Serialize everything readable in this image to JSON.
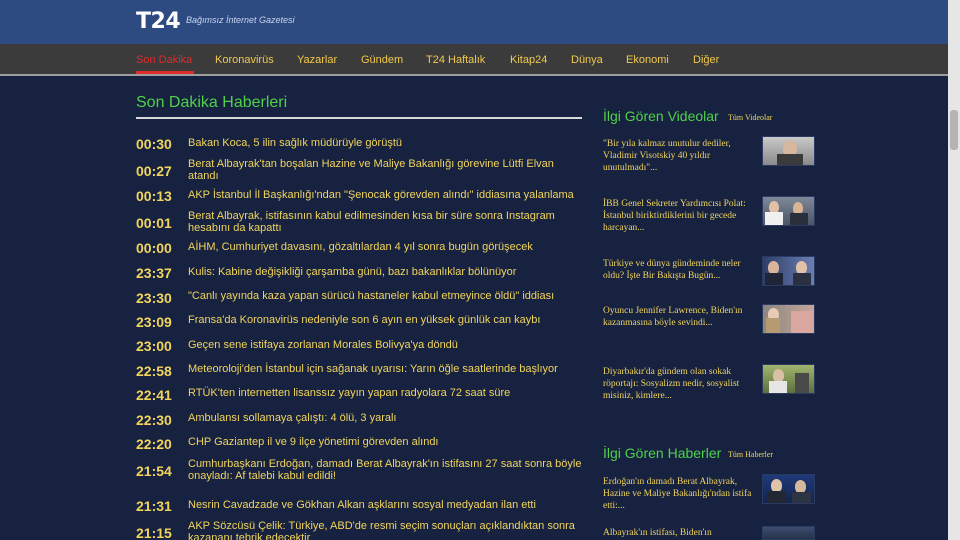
{
  "site": {
    "logo": "T24",
    "tagline": "Bağımsız İnternet Gazetesi"
  },
  "nav": {
    "items": [
      {
        "label": "Son Dakika",
        "active": true
      },
      {
        "label": "Koronavirüs"
      },
      {
        "label": "Yazarlar"
      },
      {
        "label": "Gündem"
      },
      {
        "label": "T24 Haftalık"
      },
      {
        "label": "Kitap24"
      },
      {
        "label": "Dünya"
      },
      {
        "label": "Ekonomi"
      },
      {
        "label": "Diğer"
      }
    ]
  },
  "main": {
    "title": "Son Dakika Haberleri",
    "news": [
      {
        "time": "00:30",
        "title": "Bakan Koca, 5 ilin sağlık müdürüyle görüştü"
      },
      {
        "time": "00:27",
        "title": "Berat Albayrak'tan boşalan Hazine ve Maliye Bakanlığı görevine Lütfi Elvan atandı"
      },
      {
        "time": "00:13",
        "title": "AKP İstanbul İl Başkanlığı'ndan \"Şenocak görevden alındı\" iddiasına yalanlama"
      },
      {
        "time": "00:01",
        "title": "Berat Albayrak, istifasının kabul edilmesinden kısa bir süre sonra Instagram hesabını da kapattı"
      },
      {
        "time": "00:00",
        "title": "AİHM, Cumhuriyet davasını, gözaltılardan 4 yıl sonra bugün görüşecek"
      },
      {
        "time": "23:37",
        "title": "Kulis: Kabine değişikliği çarşamba günü, bazı bakanlıklar bölünüyor"
      },
      {
        "time": "23:30",
        "title": "\"Canlı yayında kaza yapan sürücü hastaneler kabul etmeyince öldü\" iddiası"
      },
      {
        "time": "23:09",
        "title": "Fransa'da Koronavirüs nedeniyle son 6 ayın en yüksek günlük can kaybı"
      },
      {
        "time": "23:00",
        "title": "Geçen sene istifaya zorlanan Morales Bolivya'ya döndü"
      },
      {
        "time": "22:58",
        "title": "Meteoroloji'den İstanbul için sağanak uyarısı: Yarın öğle saatlerinde başlıyor"
      },
      {
        "time": "22:41",
        "title": "RTÜK'ten internetten lisanssız yayın yapan radyolara 72 saat süre"
      },
      {
        "time": "22:30",
        "title": "Ambulansı sollamaya çalıştı: 4 ölü, 3 yaralı"
      },
      {
        "time": "22:20",
        "title": "CHP Gaziantep il ve 9 ilçe yönetimi görevden alındı"
      },
      {
        "time": "21:54",
        "title": "Cumhurbaşkanı Erdoğan, damadı Berat Albayrak'ın istifasını 27 saat sonra böyle onayladı: Af talebi kabul edildi!"
      },
      {
        "time": "21:31",
        "title": "Nesrin Cavadzade ve Gökhan Alkan aşklarını sosyal medyadan ilan etti"
      },
      {
        "time": "21:15",
        "title": "AKP Sözcüsü Çelik: Türkiye, ABD'de resmi seçim sonuçları açıklandıktan sonra kazananı tebrik edecektir"
      }
    ]
  },
  "videos": {
    "title": "İlgi Gören Videolar",
    "link": "Tüm Videolar",
    "items": [
      {
        "text": "\"Bir yıla kalmaz unutulur dediler, Vladimir Visotskiy 40 yıldır unutulmadı\"..."
      },
      {
        "text": "İBB Genel Sekreter Yardımcısı Polat: İstanbul biriktirdiklerini bir gecede harcayan..."
      },
      {
        "text": "Türkiye ve dünya gündeminde neler oldu? İşte Bir Bakışta Bugün..."
      },
      {
        "text": "Oyuncu Jennifer Lawrence, Biden'ın kazanmasına böyle sevindi..."
      },
      {
        "text": "Diyarbakır'da gündem olan sokak röportajı: Sosyalizm nedir, sosyalist misiniz, kimlere..."
      }
    ]
  },
  "popular_news": {
    "title": "İlgi Gören Haberler",
    "link": "Tüm Haberler",
    "items": [
      {
        "text": "Erdoğan'ın damadı Berat Albayrak, Hazine ve Maliye Bakanlığı'ndan istifa etti:..."
      },
      {
        "text": "Albayrak'ın istifası, Biden'ın"
      }
    ]
  },
  "colors": {
    "background": "#162240",
    "topbar": "#2d4b80",
    "navbar": "#3b3b3b",
    "accent_green": "#4fd14a",
    "link_yellow": "#f2d45c",
    "active_red": "#e02b2b"
  }
}
